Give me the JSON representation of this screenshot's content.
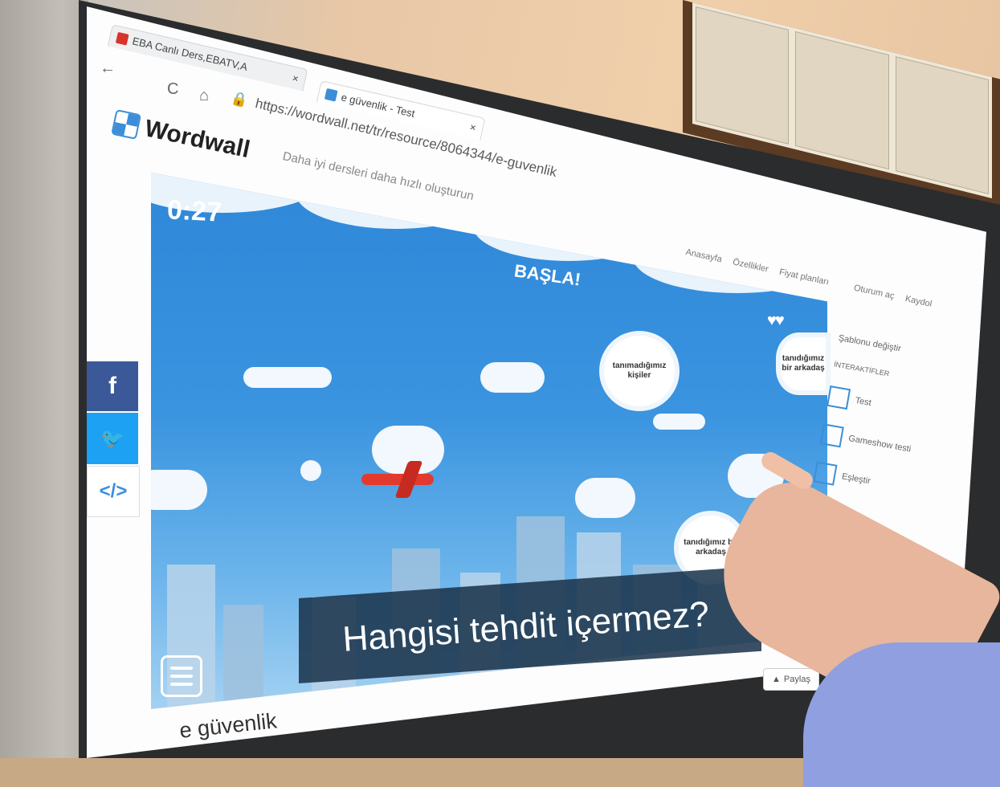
{
  "browser": {
    "tab1_title": "EBA Canlı Ders,EBATV,A",
    "tab1_close": "×",
    "tab2_title": "e güvenlik - Test",
    "tab2_close": "×",
    "back_glyph": "←",
    "reload_glyph": "C",
    "home_glyph": "⌂",
    "url": "https://wordwall.net/tr/resource/8064344/e-guvenlik"
  },
  "site": {
    "logo_text": "Wordwall",
    "tagline": "Daha iyi dersleri daha hızlı oluşturun",
    "nav": [
      "Anasayfa",
      "Özellikler",
      "Fiyat planları",
      "Oturum aç",
      "Kaydol"
    ]
  },
  "game": {
    "timer": "0:27",
    "start_label": "BAŞLA!",
    "hearts": "♥♥",
    "question": "Hangisi tehdit içermez?",
    "answers": [
      {
        "text": "tanımadığımız kişiler"
      },
      {
        "text": "tanıdığımız bir arkadaş"
      },
      {
        "text": "tanıdığımız bir arkadaş"
      }
    ]
  },
  "social": {
    "facebook": "f",
    "twitter": "🐦",
    "embed": "</>"
  },
  "right_panel": {
    "heading": "Şablonu değiştir",
    "subheading": "İNTERAKTİFLER",
    "items": [
      "Test",
      "Gameshow testi",
      "Eşleştir"
    ]
  },
  "share_label": "Paylaş",
  "page_title": "e güvenlik",
  "colors": {
    "sky": "#2f87d8",
    "plane": "#e23a2e",
    "facebook": "#3b5998",
    "twitter": "#1da1f2"
  }
}
